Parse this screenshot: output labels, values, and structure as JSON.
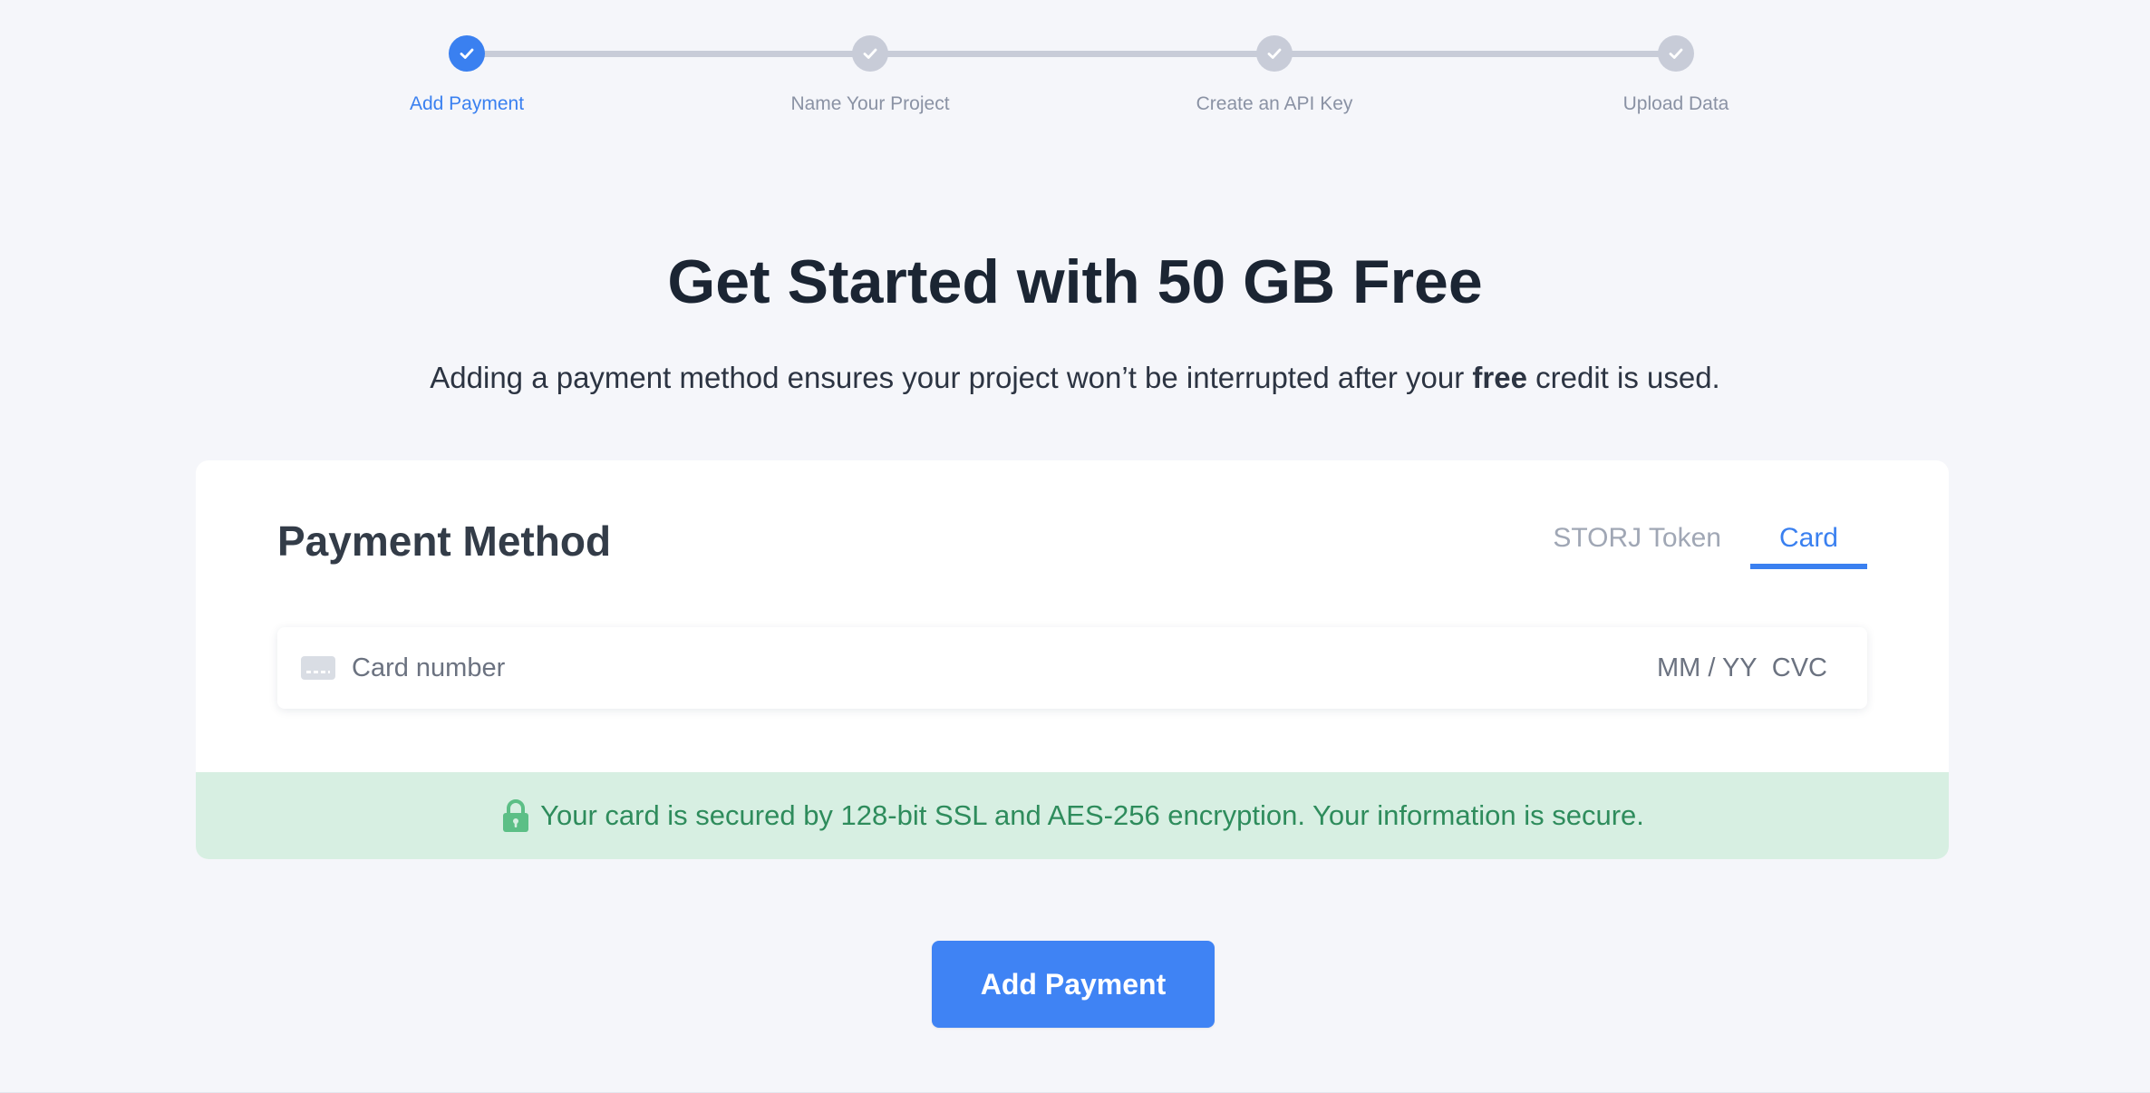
{
  "stepper": {
    "steps": [
      {
        "label": "Add Payment",
        "state": "active"
      },
      {
        "label": "Name Your Project",
        "state": "pending"
      },
      {
        "label": "Create an API Key",
        "state": "pending"
      },
      {
        "label": "Upload Data",
        "state": "pending"
      }
    ]
  },
  "hero": {
    "title": "Get Started with 50 GB Free",
    "subtitle_before": "Adding a payment method ensures your project won’t be interrupted after your ",
    "subtitle_bold": "free",
    "subtitle_after": " credit is used."
  },
  "payment_card": {
    "title": "Payment Method",
    "tabs": {
      "token_label": "STORJ Token",
      "card_label": "Card",
      "active": "Card"
    },
    "card_input": {
      "placeholder": "Card number",
      "expiry_placeholder": "MM / YY",
      "cvc_placeholder": "CVC"
    },
    "secure_banner": {
      "text": "Your card is secured by 128-bit SSL and AES-256 encryption. Your information is secure."
    }
  },
  "actions": {
    "add_payment_label": "Add Payment"
  },
  "colors": {
    "accent": "#3a80f0",
    "background": "#f5f6fa",
    "step_inactive": "#c8ccd8",
    "secure_bg": "#d7efe2",
    "secure_text": "#2e8c5c"
  },
  "icons": {
    "step_check": "check-icon",
    "card": "credit-card-icon",
    "lock": "lock-icon"
  }
}
